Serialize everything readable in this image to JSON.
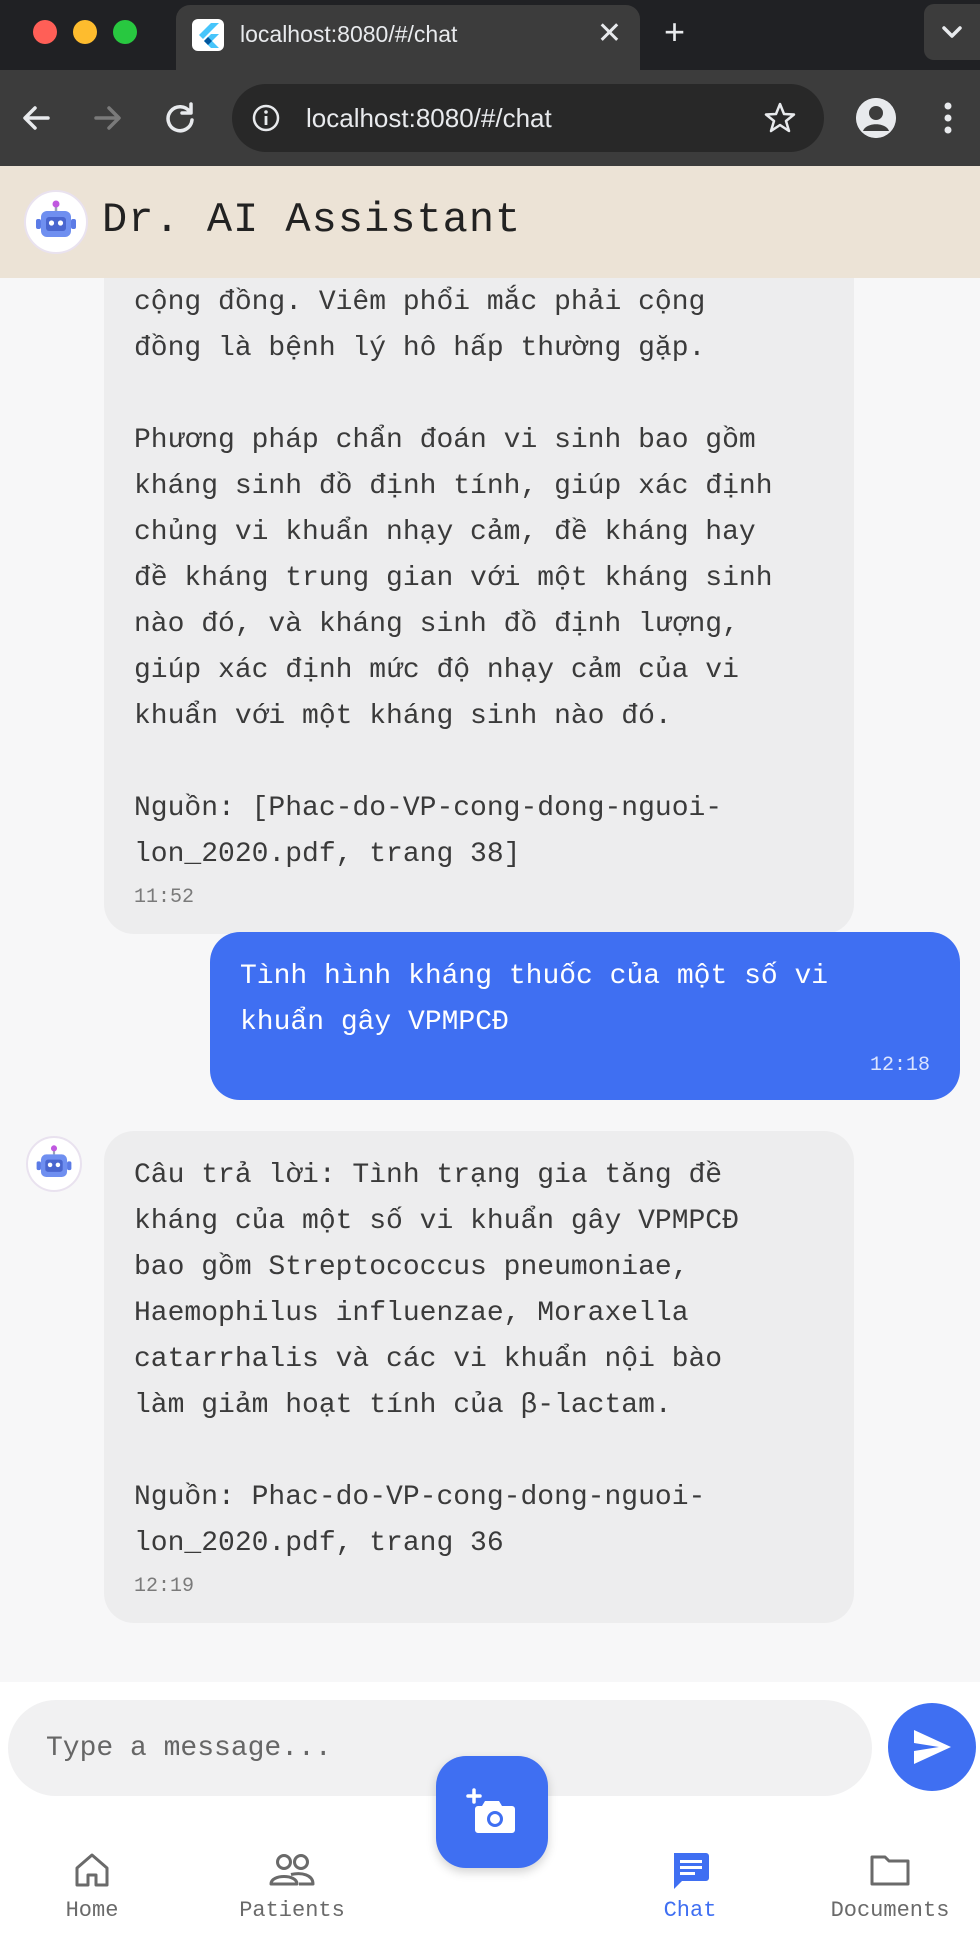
{
  "browser": {
    "tab_title": "localhost:8080/#/chat",
    "tab_close": "✕",
    "new_tab": "+",
    "url": "localhost:8080/#/chat"
  },
  "app": {
    "title": "Dr. AI Assistant"
  },
  "messages": [
    {
      "sender": "bot",
      "text": "cộng đồng. Viêm phổi mắc phải cộng\nđồng là bệnh lý hô hấp thường gặp.\n\nPhương pháp chẩn đoán vi sinh bao gồm\nkháng sinh đồ định tính, giúp xác định\nchủng vi khuẩn nhạy cảm, đề kháng hay\nđề kháng trung gian với một kháng sinh\nnào đó, và kháng sinh đồ định lượng,\ngiúp xác định mức độ nhạy cảm của vi\nkhuẩn với một kháng sinh nào đó.\n\nNguồn: [Phac-do-VP-cong-dong-nguoi-\nlon_2020.pdf, trang 38]",
      "time": "11:52"
    },
    {
      "sender": "user",
      "text": "Tình hình kháng thuốc của một số vi\nkhuẩn gây VPMPCĐ",
      "time": "12:18"
    },
    {
      "sender": "bot",
      "text": "Câu trả lời: Tình trạng gia tăng đề\nkháng của một số vi khuẩn gây VPMPCĐ\nbao gồm Streptococcus pneumoniae,\nHaemophilus influenzae, Moraxella\ncatarrhalis và các vi khuẩn nội bào\nlàm giảm hoạt tính của β-lactam.\n\nNguồn: Phac-do-VP-cong-dong-nguoi-\nlon_2020.pdf, trang 36",
      "time": "12:19"
    }
  ],
  "composer": {
    "placeholder": "Type a message..."
  },
  "bottom_nav": {
    "items": [
      {
        "label": "Home",
        "icon": "home-icon",
        "active": false
      },
      {
        "label": "Patients",
        "icon": "patients-icon",
        "active": false
      },
      {
        "label": "Chat",
        "icon": "chat-icon",
        "active": true
      },
      {
        "label": "Documents",
        "icon": "folder-icon",
        "active": false
      }
    ]
  },
  "colors": {
    "accent": "#3f6ff2",
    "header_bg": "#ece3d6",
    "bot_bubble": "#ededee",
    "chat_bg": "#f7f7f8"
  }
}
